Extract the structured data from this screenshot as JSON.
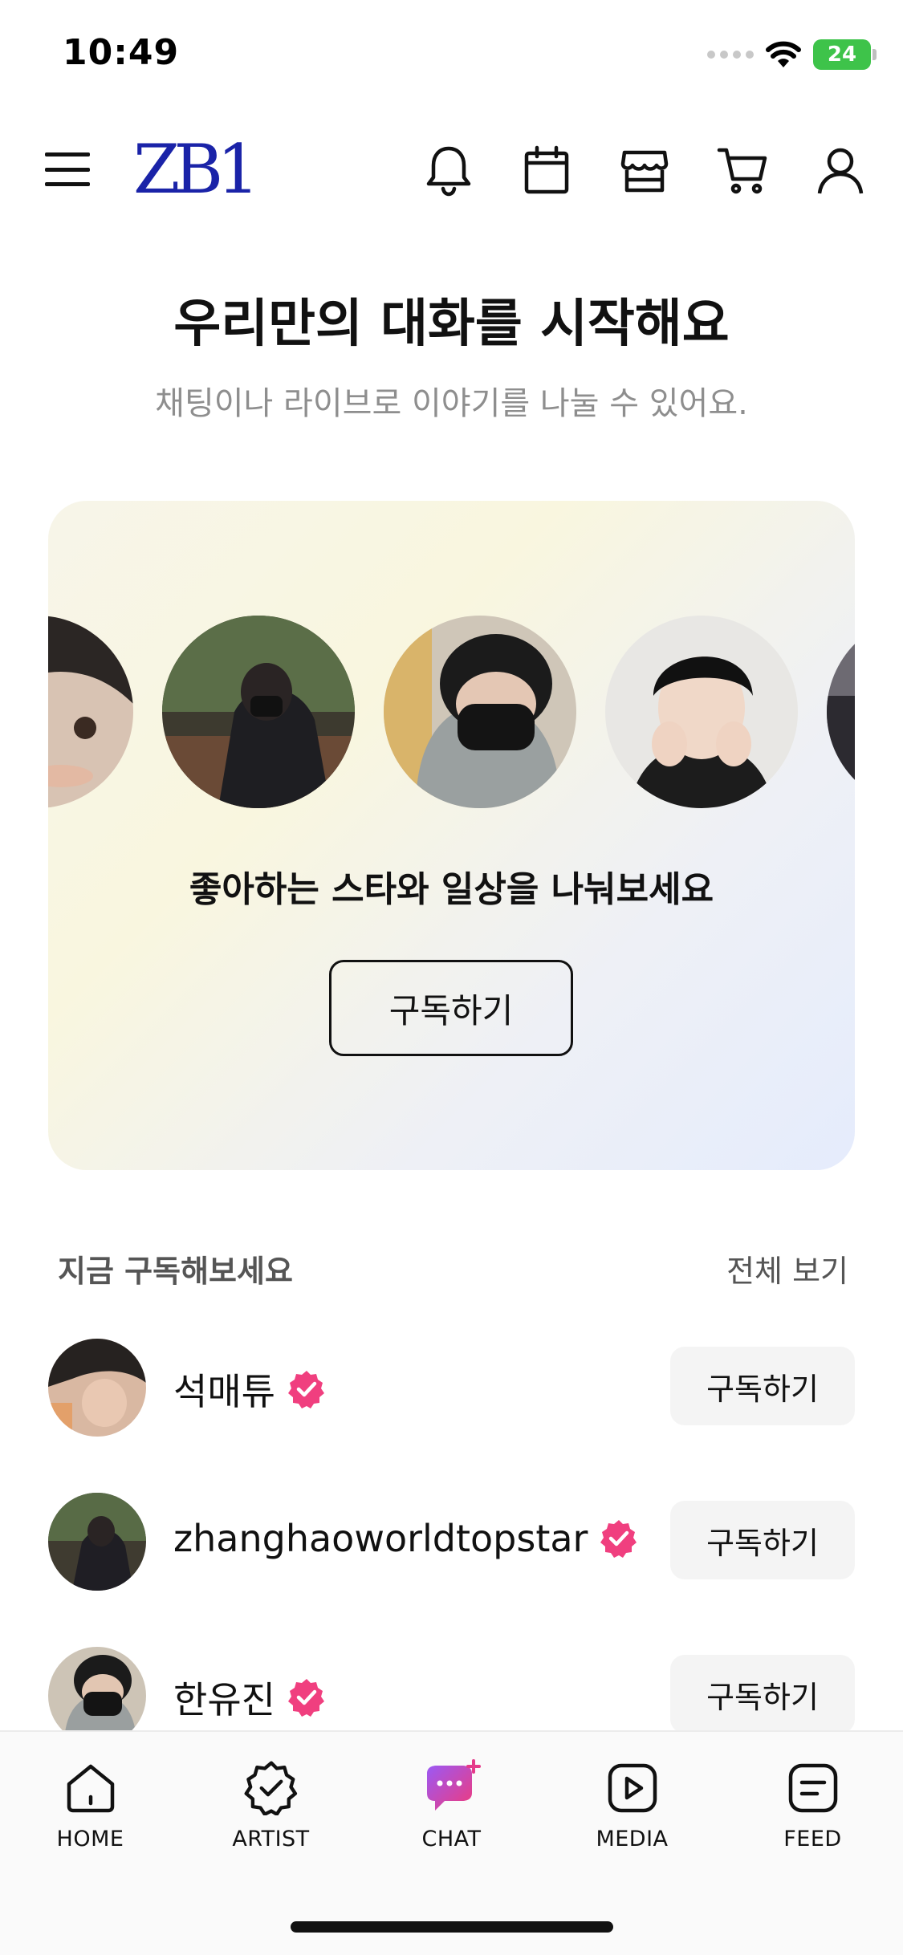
{
  "status_bar": {
    "time": "10:49",
    "battery": "24"
  },
  "header": {
    "logo": "ZB1",
    "icons": [
      "menu-icon",
      "bell-icon",
      "calendar-icon",
      "store-icon",
      "cart-icon",
      "profile-icon"
    ]
  },
  "intro": {
    "title": "우리만의 대화를 시작해요",
    "subtitle": "채팅이나 라이브로 이야기를 나눌 수 있어요."
  },
  "promo": {
    "text": "좋아하는 스타와 일상을 나눠보세요",
    "button_label": "구독하기"
  },
  "suggestions": {
    "title": "지금 구독해보세요",
    "see_all": "전체 보기",
    "artists": [
      {
        "name": "석매튜",
        "button": "구독하기",
        "verified": true
      },
      {
        "name": "zhanghaoworldtopstar",
        "button": "구독하기",
        "verified": true
      },
      {
        "name": "한유진",
        "button": "구독하기",
        "verified": true
      }
    ]
  },
  "bottom_nav": {
    "items": [
      {
        "label": "HOME",
        "icon": "home-icon"
      },
      {
        "label": "ARTIST",
        "icon": "artist-badge-icon"
      },
      {
        "label": "CHAT",
        "icon": "chat-icon",
        "active": true
      },
      {
        "label": "MEDIA",
        "icon": "play-icon"
      },
      {
        "label": "FEED",
        "icon": "feed-icon"
      }
    ]
  },
  "colors": {
    "logo": "#1a23a8",
    "verified": "#f03f7f",
    "chat_accent": "#e53a8a",
    "battery": "#3ec34a"
  }
}
